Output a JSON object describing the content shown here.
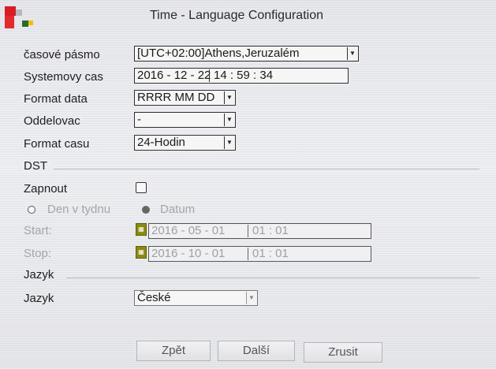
{
  "window": {
    "title": "Time - Language Configuration"
  },
  "form": {
    "timezone": {
      "label": "časové pásmo",
      "value": "[UTC+02:00]Athens,Jeruzalém"
    },
    "system_time": {
      "label": "Systemovy cas",
      "date": "2016 - 12 - 22",
      "time": "14 : 59 : 34"
    },
    "date_format": {
      "label": "Format data",
      "value": "RRRR MM DD"
    },
    "separator": {
      "label": "Oddelovac",
      "value": "-"
    },
    "time_format": {
      "label": "Format casu",
      "value": "24-Hodin"
    }
  },
  "dst": {
    "section_label": "DST",
    "enable": {
      "label": "Zapnout",
      "checked": false
    },
    "mode_week_label": "Den v tydnu",
    "mode_date_label": "Datum",
    "selected_mode": "Datum",
    "start": {
      "label": "Start:",
      "date": "2016 - 05 - 01",
      "time": "01 : 01"
    },
    "stop": {
      "label": "Stop:",
      "date": "2016 - 10 - 01",
      "time": "01 : 01"
    }
  },
  "language": {
    "section_label": "Jazyk",
    "label": "Jazyk",
    "value": "České"
  },
  "buttons": {
    "back": "Zpět",
    "next": "Další",
    "cancel": "Zrusit"
  },
  "icons": {
    "dropdown": "chevron-down-icon",
    "calendar": "calendar-icon"
  },
  "colors": {
    "background": "#eceef0",
    "calendar_icon": "#8a8a10"
  }
}
